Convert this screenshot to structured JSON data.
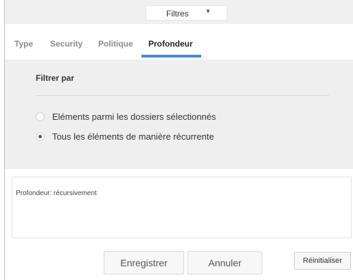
{
  "toolbar": {
    "filter_label": "Filtres",
    "filter_caret": "▼"
  },
  "tabs": [
    {
      "label": "Type"
    },
    {
      "label": "Security"
    },
    {
      "label": "Politique"
    },
    {
      "label": "Profondeur",
      "active": true
    }
  ],
  "panel": {
    "title": "Filtrer par",
    "options": [
      {
        "label": "Eléments parmi les dossiers sélectionnés",
        "checked": false
      },
      {
        "label": "Tous les éléments de manière récurrente",
        "checked": true
      }
    ]
  },
  "description": {
    "text": "Profondeur: récursivement"
  },
  "buttons": {
    "save": "Enregistrer",
    "cancel": "Annuler",
    "reset": "Réinitialiser"
  },
  "colors": {
    "accent": "#3e8ed0",
    "panel_bg": "#efefef",
    "topbar_bg": "#f0f0f0"
  }
}
